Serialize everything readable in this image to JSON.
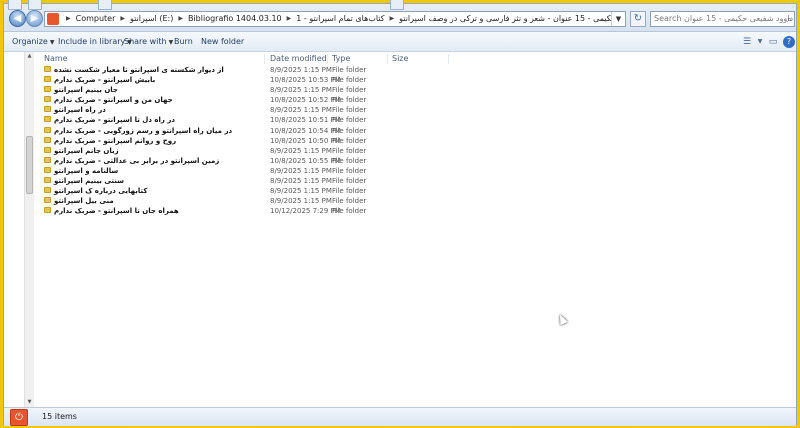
{
  "address_bar": {
    "back_label": "◀",
    "forward_label": "▶",
    "crumbs": [
      "Computer",
      "اسپرانتو (E:)",
      "Bibliografio 1404.03.10",
      "کتاب‌های تمام اسپرانتو - 1",
      "کتاب های داوود شفیعی حکیمی - 15 عنوان - شعر و نثر فارسی و ترکی در وصف اسپرانتو"
    ],
    "dropdown": "▼",
    "refresh": "↻",
    "search_placeholder": "Search کتاب های داوود شفیعی حکیمی - 15 عنوان",
    "search_icon": "⌕"
  },
  "toolbar": {
    "organize": "Organize",
    "include_in_library": "Include in library",
    "share_with": "Share with",
    "burn": "Burn",
    "new_folder": "New folder",
    "caret": "▼",
    "views_icon": "☰",
    "preview_icon": "▭",
    "help_icon": "?"
  },
  "columns": {
    "name": "Name",
    "date_modified": "Date modified",
    "type": "Type",
    "size": "Size"
  },
  "files": [
    {
      "name": "از دیوار شکسته ی اسپرانتو تا معیار شکست نشده",
      "date": "8/9/2025 1:15 PM",
      "type": "File folder"
    },
    {
      "name": "بابیش اسپرانتو - ضربک ندارم",
      "date": "10/8/2025 10:53 PM",
      "type": "File folder"
    },
    {
      "name": "جان بینیم اسپرانتو",
      "date": "8/9/2025 1:15 PM",
      "type": "File folder"
    },
    {
      "name": "جهان من و اسپرانتو - ضربک ندارم",
      "date": "10/8/2025 10:52 PM",
      "type": "File folder"
    },
    {
      "name": "در راه اسپرانتو",
      "date": "8/9/2025 1:15 PM",
      "type": "File folder"
    },
    {
      "name": "در راه دل تا اسپرانتو - ضربک ندارم",
      "date": "10/8/2025 10:51 PM",
      "type": "File folder"
    },
    {
      "name": "در میان راه اسپرانتو و رسم زورگویی - ضربک ندارم",
      "date": "10/8/2025 10:54 PM",
      "type": "File folder"
    },
    {
      "name": "روح و روانم اسپرانتو - ضربک ندارم",
      "date": "10/8/2025 10:50 PM",
      "type": "File folder"
    },
    {
      "name": "زبان جانم اسپرانتو",
      "date": "8/9/2025 1:15 PM",
      "type": "File folder"
    },
    {
      "name": "زمین اسپرانتو در برابر بی عدالتی - ضربک ندارم",
      "date": "10/8/2025 10:55 PM",
      "type": "File folder"
    },
    {
      "name": "سالنامه و اسپرانتو",
      "date": "8/9/2025 1:15 PM",
      "type": "File folder"
    },
    {
      "name": "سنتی بینیم اسپرانتو",
      "date": "8/9/2025 1:15 PM",
      "type": "File folder"
    },
    {
      "name": "کتابهایی درباره ک اسپرانتو",
      "date": "8/9/2025 1:15 PM",
      "type": "File folder"
    },
    {
      "name": "منی بیل اسپرانتو",
      "date": "8/9/2025 1:15 PM",
      "type": "File folder"
    },
    {
      "name": "همراه جان تا اسپرانتو - ضربک ندارم",
      "date": "10/12/2025 7:29 PM",
      "type": "File folder"
    }
  ],
  "status": {
    "item_count": "15 items",
    "power_icon": "⏻"
  },
  "colors": {
    "frame": "#f0c808",
    "folder": "#e8c15a",
    "accent": "#e8552e"
  }
}
